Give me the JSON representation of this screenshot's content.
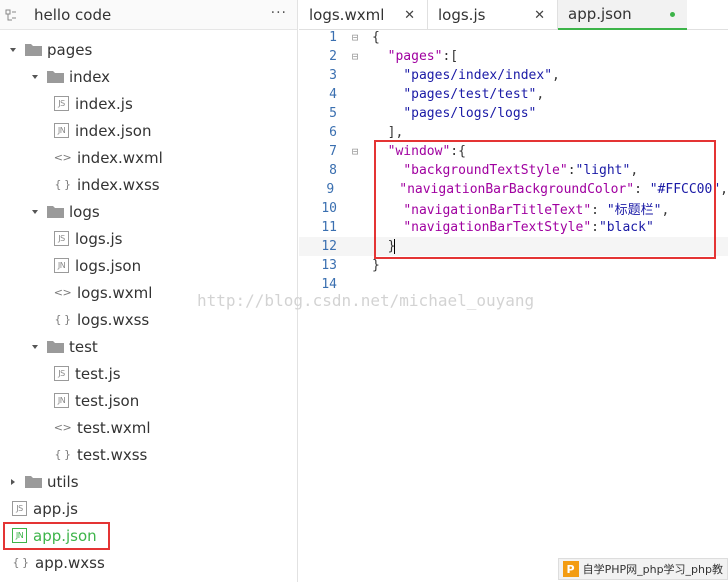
{
  "sidebar": {
    "title": "hello code",
    "more_label": "···",
    "tree": [
      {
        "type": "folder",
        "label": "pages",
        "depth": 0,
        "expanded": true
      },
      {
        "type": "folder",
        "label": "index",
        "depth": 1,
        "expanded": true
      },
      {
        "type": "file",
        "label": "index.js",
        "depth": 2,
        "icon": "JS"
      },
      {
        "type": "file",
        "label": "index.json",
        "depth": 2,
        "icon": "JN"
      },
      {
        "type": "file",
        "label": "index.wxml",
        "depth": 2,
        "icon": "<>"
      },
      {
        "type": "file",
        "label": "index.wxss",
        "depth": 2,
        "icon": "{ }"
      },
      {
        "type": "folder",
        "label": "logs",
        "depth": 1,
        "expanded": true
      },
      {
        "type": "file",
        "label": "logs.js",
        "depth": 2,
        "icon": "JS"
      },
      {
        "type": "file",
        "label": "logs.json",
        "depth": 2,
        "icon": "JN"
      },
      {
        "type": "file",
        "label": "logs.wxml",
        "depth": 2,
        "icon": "<>"
      },
      {
        "type": "file",
        "label": "logs.wxss",
        "depth": 2,
        "icon": "{ }"
      },
      {
        "type": "folder",
        "label": "test",
        "depth": 1,
        "expanded": true
      },
      {
        "type": "file",
        "label": "test.js",
        "depth": 2,
        "icon": "JS"
      },
      {
        "type": "file",
        "label": "test.json",
        "depth": 2,
        "icon": "JN"
      },
      {
        "type": "file",
        "label": "test.wxml",
        "depth": 2,
        "icon": "<>"
      },
      {
        "type": "file",
        "label": "test.wxss",
        "depth": 2,
        "icon": "{ }"
      },
      {
        "type": "folder",
        "label": "utils",
        "depth": 0,
        "expanded": false
      },
      {
        "type": "file",
        "label": "app.js",
        "depth": 0,
        "icon": "JS"
      },
      {
        "type": "file",
        "label": "app.json",
        "depth": 0,
        "icon": "JN",
        "active": true
      },
      {
        "type": "file",
        "label": "app.wxss",
        "depth": 0,
        "icon": "{ }"
      }
    ]
  },
  "tabs": [
    {
      "label": "logs.wxml",
      "close": "✕"
    },
    {
      "label": "logs.js",
      "close": "✕"
    },
    {
      "label": "app.json",
      "active": true
    }
  ],
  "code_lines": [
    {
      "n": "1",
      "fold": "⊟",
      "html": "<span class='p'>{</span>"
    },
    {
      "n": "2",
      "fold": "⊟",
      "html": "  <span class='k'>\"pages\"</span><span class='p'>:[</span>"
    },
    {
      "n": "3",
      "fold": "",
      "html": "    <span class='s'>\"pages/index/index\"</span><span class='p'>,</span>"
    },
    {
      "n": "4",
      "fold": "",
      "html": "    <span class='s'>\"pages/test/test\"</span><span class='p'>,</span>"
    },
    {
      "n": "5",
      "fold": "",
      "html": "    <span class='s'>\"pages/logs/logs\"</span>"
    },
    {
      "n": "6",
      "fold": "",
      "html": "  <span class='p'>],</span>"
    },
    {
      "n": "7",
      "fold": "⊟",
      "html": "  <span class='k'>\"window\"</span><span class='p'>:{</span>"
    },
    {
      "n": "8",
      "fold": "",
      "html": "    <span class='k'>\"backgroundTextStyle\"</span><span class='p'>:</span><span class='s'>\"light\"</span><span class='p'>,</span>"
    },
    {
      "n": "9",
      "fold": "",
      "html": "    <span class='k'>\"navigationBarBackgroundColor\"</span><span class='p'>: </span><span class='s'>\"#FFCC00\"</span><span class='p'>,</span>"
    },
    {
      "n": "10",
      "fold": "",
      "html": "    <span class='k'>\"navigationBarTitleText\"</span><span class='p'>: </span><span class='s'>\"标题栏\"</span><span class='p'>,</span>"
    },
    {
      "n": "11",
      "fold": "",
      "html": "    <span class='k'>\"navigationBarTextStyle\"</span><span class='p'>:</span><span class='s'>\"black\"</span>"
    },
    {
      "n": "12",
      "fold": "",
      "html": "  <span class='p'>}</span><span class='cursor'></span>"
    },
    {
      "n": "13",
      "fold": "",
      "html": "<span class='p'>}</span>"
    },
    {
      "n": "14",
      "fold": "",
      "html": ""
    }
  ],
  "watermark": "http://blog.csdn.net/michael_ouyang",
  "badge": {
    "icon": "P",
    "text": "自学PHP网_php学习_php教"
  },
  "colors": {
    "accent_green": "#3db449",
    "highlight_red": "#e43434",
    "line_number_blue": "#3a6fb0"
  }
}
